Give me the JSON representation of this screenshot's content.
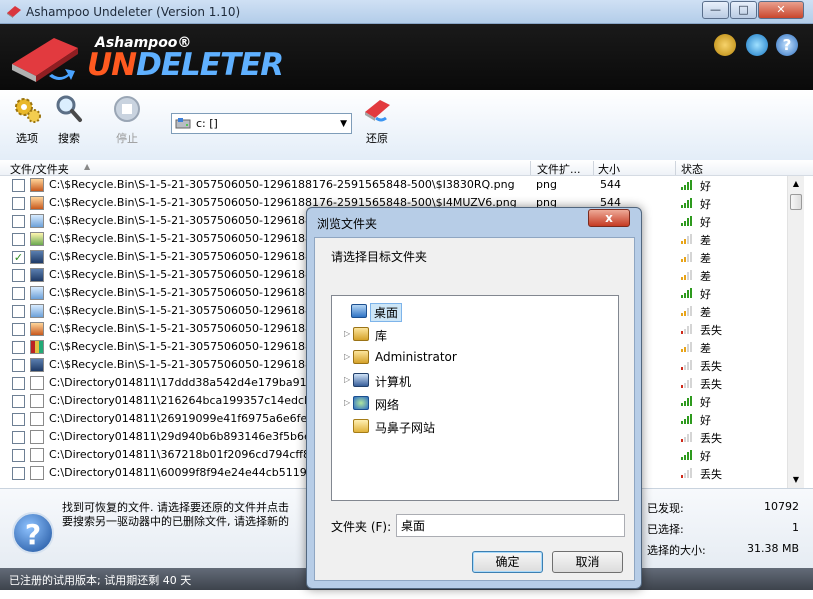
{
  "window": {
    "title": "Ashampoo Undeleter (Version 1.10)"
  },
  "banner": {
    "brand_small": "Ashampoo®",
    "brand_un": "UN",
    "brand_rest": "DELETER",
    "help_glyph": "?"
  },
  "toolbar": {
    "options": "选项",
    "search": "搜索",
    "stop": "停止",
    "restore": "还原",
    "drive": "c: []"
  },
  "columns": {
    "name": "文件/文件夹",
    "ext": "文件扩...",
    "size": "大小",
    "status": "状态"
  },
  "files": [
    {
      "path": "C:\\$Recycle.Bin\\S-1-5-21-3057506050-1296188176-2591565848-500\\$I3830RQ.png",
      "ext": "png",
      "size": "544",
      "status": "好",
      "checked": false,
      "icon": "t-img2",
      "level": 4
    },
    {
      "path": "C:\\$Recycle.Bin\\S-1-5-21-3057506050-1296188176-2591565848-500\\$I4MUZV6.png",
      "ext": "png",
      "size": "544",
      "status": "好",
      "checked": false,
      "icon": "t-img2",
      "level": 4
    },
    {
      "path": "C:\\$Recycle.Bin\\S-1-5-21-3057506050-1296188176-2",
      "ext": "",
      "size": "",
      "status": "好",
      "checked": false,
      "icon": "t-img",
      "level": 4
    },
    {
      "path": "C:\\$Recycle.Bin\\S-1-5-21-3057506050-1296188176-2",
      "ext": "",
      "size": "",
      "status": "差",
      "checked": false,
      "icon": "t-sh",
      "level": 2
    },
    {
      "path": "C:\\$Recycle.Bin\\S-1-5-21-3057506050-1296188176-2",
      "ext": "",
      "size": "",
      "status": "差",
      "checked": true,
      "icon": "t-vid",
      "level": 2
    },
    {
      "path": "C:\\$Recycle.Bin\\S-1-5-21-3057506050-1296188176-2",
      "ext": "",
      "size": "",
      "status": "差",
      "checked": false,
      "icon": "t-vid",
      "level": 2
    },
    {
      "path": "C:\\$Recycle.Bin\\S-1-5-21-3057506050-1296188176-2",
      "ext": "",
      "size": "",
      "status": "好",
      "checked": false,
      "icon": "t-img",
      "level": 4
    },
    {
      "path": "C:\\$Recycle.Bin\\S-1-5-21-3057506050-1296188176-2",
      "ext": "",
      "size": "",
      "status": "差",
      "checked": false,
      "icon": "t-img",
      "level": 2
    },
    {
      "path": "C:\\$Recycle.Bin\\S-1-5-21-3057506050-1296188176-2",
      "ext": "",
      "size": "",
      "status": "丢失",
      "checked": false,
      "icon": "t-img2",
      "level": 1
    },
    {
      "path": "C:\\$Recycle.Bin\\S-1-5-21-3057506050-1296188176-2",
      "ext": "",
      "size": "",
      "status": "差",
      "checked": false,
      "icon": "t-zip",
      "level": 2
    },
    {
      "path": "C:\\$Recycle.Bin\\S-1-5-21-3057506050-1296188176-2",
      "ext": "",
      "size": "",
      "status": "丢失",
      "checked": false,
      "icon": "t-vid",
      "level": 1
    },
    {
      "path": "C:\\Directory014811\\17ddd38a542d4e179ba91d8d1ab",
      "ext": "",
      "size": "",
      "status": "丢失",
      "checked": false,
      "icon": "t-doc",
      "level": 1
    },
    {
      "path": "C:\\Directory014811\\216264bca199357c14edcb66f31",
      "ext": "",
      "size": "",
      "status": "好",
      "checked": false,
      "icon": "t-doc",
      "level": 4
    },
    {
      "path": "C:\\Directory014811\\26919099e41f6975a6e6fe3b2c4",
      "ext": "",
      "size": "",
      "status": "好",
      "checked": false,
      "icon": "t-doc",
      "level": 4
    },
    {
      "path": "C:\\Directory014811\\29d940b6b893146e3f5b6eb257c",
      "ext": "",
      "size": "",
      "status": "丢失",
      "checked": false,
      "icon": "t-doc",
      "level": 1
    },
    {
      "path": "C:\\Directory014811\\367218b01f2096cd794cff84927b",
      "ext": "",
      "size": "",
      "status": "好",
      "checked": false,
      "icon": "t-doc",
      "level": 4
    },
    {
      "path": "C:\\Directory014811\\60099f8f94e24e44cb51199db92",
      "ext": "",
      "size": "",
      "status": "丢失",
      "checked": false,
      "icon": "t-doc",
      "level": 1
    }
  ],
  "info": {
    "line1": "找到可恢复的文件. 请选择要还原的文件并点击",
    "line2": "要搜索另一驱动器中的已删除文件, 请选择新的",
    "found_label": "已发现:",
    "found_value": "10792",
    "selected_label": "已选择:",
    "selected_value": "1",
    "size_label": "选择的大小:",
    "size_value": "31.38 MB"
  },
  "statusbar": {
    "text": "已注册的试用版本; 试用期还剩 40 天"
  },
  "dialog": {
    "title": "浏览文件夹",
    "close": "x",
    "prompt": "请选择目标文件夹",
    "tree": [
      {
        "label": "桌面",
        "expander": "",
        "icon": "i-desk",
        "indent": 0,
        "selected": true
      },
      {
        "label": "库",
        "expander": "▷",
        "icon": "i-lib",
        "indent": 1,
        "selected": false
      },
      {
        "label": "Administrator",
        "expander": "▷",
        "icon": "i-user",
        "indent": 1,
        "selected": false
      },
      {
        "label": "计算机",
        "expander": "▷",
        "icon": "i-pc",
        "indent": 1,
        "selected": false
      },
      {
        "label": "网络",
        "expander": "▷",
        "icon": "i-net",
        "indent": 1,
        "selected": false
      },
      {
        "label": "马鼻子网站",
        "expander": "",
        "icon": "i-fold",
        "indent": 1,
        "selected": false
      }
    ],
    "folder_label": "文件夹 (F):",
    "folder_value": "桌面",
    "ok": "确定",
    "cancel": "取消"
  },
  "colors": {
    "good": "#2e9a1e",
    "poor": "#e8a419",
    "lost": "#d02a1a",
    "accent": "#ff5a20"
  }
}
